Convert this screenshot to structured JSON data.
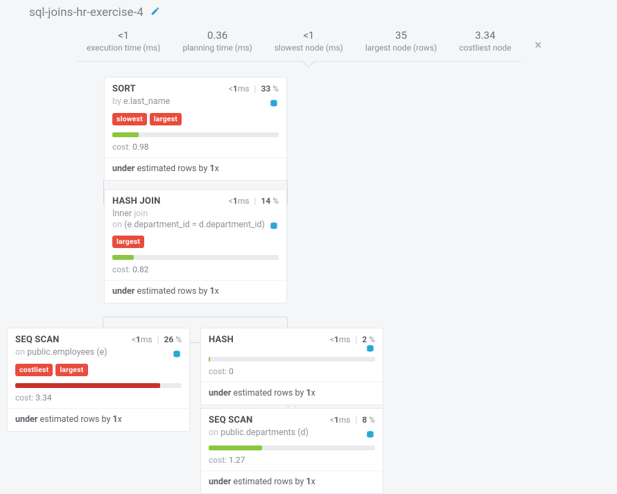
{
  "title": "sql-joins-hr-exercise-4",
  "icons": {
    "edit": "pencil-icon",
    "close": "×",
    "disk": "disk-icon"
  },
  "colors": {
    "accent": "#3498db",
    "tag": "#e84c3d",
    "bar_green": "#8cc63f",
    "bar_red": "#c9322a"
  },
  "stats": [
    {
      "value": "<1",
      "label": "execution time (ms)"
    },
    {
      "value": "0.36",
      "label": "planning time (ms)"
    },
    {
      "value": "<1",
      "label": "slowest node (ms)"
    },
    {
      "value": "35",
      "label": "largest node (rows)"
    },
    {
      "value": "3.34",
      "label": "costliest node"
    }
  ],
  "arrow_glyph": "▾",
  "nodes": {
    "sort": {
      "op": "SORT",
      "time_prefix": "<",
      "time_value": "1",
      "time_unit": "ms",
      "pct": "33",
      "pct_suffix": "%",
      "detail_kw": "by",
      "detail_txt": "e.last_name",
      "tags": [
        "slowest",
        "largest"
      ],
      "bar_color": "green",
      "bar_pct": 16,
      "cost_label": "cost:",
      "cost_value": "0.98",
      "est_prefix": "under",
      "est_mid": "estimated rows by",
      "est_val": "1",
      "est_suffix": "x"
    },
    "hashjoin": {
      "op": "HASH JOIN",
      "time_prefix": "<",
      "time_value": "1",
      "time_unit": "ms",
      "pct": "14",
      "pct_suffix": "%",
      "detail_kw1": "Inner",
      "detail_kw1b": "join",
      "detail_kw2": "on",
      "detail_txt2": "(e.department_id = d.department_id)",
      "tags": [
        "largest"
      ],
      "bar_color": "green",
      "bar_pct": 13,
      "cost_label": "cost:",
      "cost_value": "0.82",
      "est_prefix": "under",
      "est_mid": "estimated rows by",
      "est_val": "1",
      "est_suffix": "x"
    },
    "seqscan_emp": {
      "op": "SEQ SCAN",
      "time_prefix": "<",
      "time_value": "1",
      "time_unit": "ms",
      "pct": "26",
      "pct_suffix": "%",
      "detail_kw": "on",
      "detail_txt": "public.employees (e)",
      "tags": [
        "costliest",
        "largest"
      ],
      "bar_color": "red",
      "bar_pct": 87,
      "cost_label": "cost:",
      "cost_value": "3.34",
      "est_prefix": "under",
      "est_mid": "estimated rows by",
      "est_val": "1",
      "est_suffix": "x"
    },
    "hash": {
      "op": "HASH",
      "time_prefix": "<",
      "time_value": "1",
      "time_unit": "ms",
      "pct": "2",
      "pct_suffix": "%",
      "detail_kw": "",
      "detail_txt": "",
      "tags": [],
      "bar_color": "green",
      "bar_pct": 1,
      "cost_label": "cost:",
      "cost_value": "0",
      "est_prefix": "under",
      "est_mid": "estimated rows by",
      "est_val": "1",
      "est_suffix": "x"
    },
    "seqscan_dep": {
      "op": "SEQ SCAN",
      "time_prefix": "<",
      "time_value": "1",
      "time_unit": "ms",
      "pct": "8",
      "pct_suffix": "%",
      "detail_kw": "on",
      "detail_txt": "public.departments (d)",
      "tags": [],
      "bar_color": "green",
      "bar_pct": 32,
      "cost_label": "cost:",
      "cost_value": "1.27",
      "est_prefix": "under",
      "est_mid": "estimated rows by",
      "est_val": "1",
      "est_suffix": "x"
    }
  }
}
